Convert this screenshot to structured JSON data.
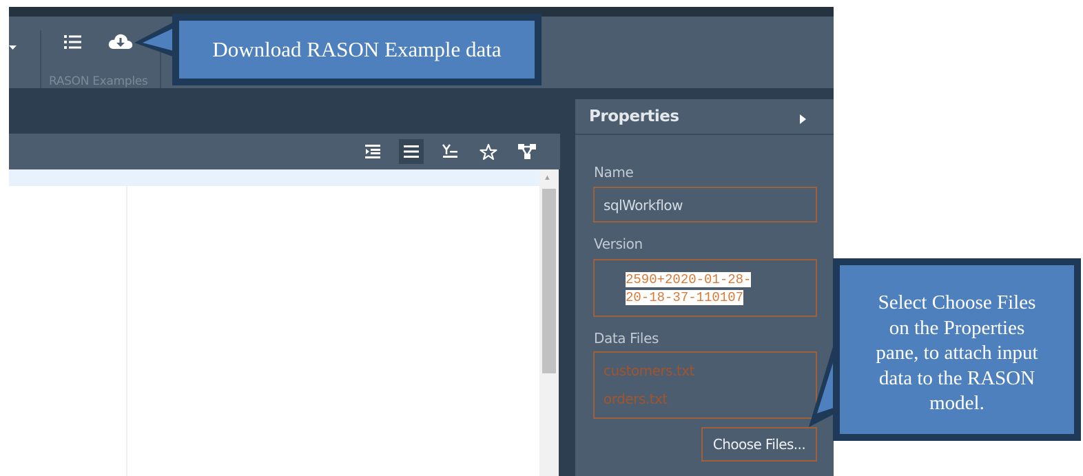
{
  "toolbar": {
    "group_label": "RASON Examples",
    "icons": [
      "dropdown-caret-icon",
      "list-icon",
      "cloud-download-icon"
    ]
  },
  "editor_toolbar": {
    "icons": [
      "indent-icon",
      "align-justify-icon",
      "sort-icon",
      "star-icon",
      "workflow-icon"
    ]
  },
  "properties": {
    "title": "Properties",
    "name_label": "Name",
    "name_value": "sqlWorkflow",
    "version_label": "Version",
    "version_line1": "2590+2020-01-28-",
    "version_line2": "20-18-37-110107",
    "data_files_label": "Data Files",
    "data_files": [
      "customers.txt",
      "orders.txt"
    ],
    "choose_files_label": "Choose Files..."
  },
  "callouts": {
    "download": "Download RASON Example data",
    "choose_line1": "Select Choose Files",
    "choose_line2": "on the Properties",
    "choose_line3": "pane, to attach input",
    "choose_line4": "data to the RASON",
    "choose_line5": "model."
  },
  "colors": {
    "toolbar": "#4b5d6e",
    "dark": "#2d3e50",
    "callout_fill": "#4e80bd",
    "callout_border": "#1f3a58",
    "accent_orange": "#d87a36"
  }
}
